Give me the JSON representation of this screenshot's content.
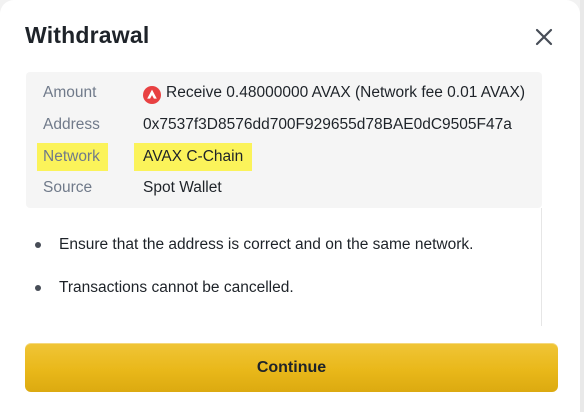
{
  "modal": {
    "title": "Withdrawal",
    "close_icon": "close-icon"
  },
  "details": {
    "amount": {
      "label": "Amount",
      "value": "Receive 0.48000000 AVAX (Network fee 0.01 AVAX)",
      "icon": "avax-icon"
    },
    "address": {
      "label": "Address",
      "value": "0x7537f3D8576dd700F929655d78BAE0dC9505F47a"
    },
    "network": {
      "label": "Network",
      "value": "AVAX C-Chain",
      "highlight_color": "#fbf35a"
    },
    "source": {
      "label": "Source",
      "value": "Spot Wallet"
    }
  },
  "notes": [
    "Ensure that the address is correct and on the same network.",
    "Transactions cannot be cancelled."
  ],
  "actions": {
    "continue_label": "Continue"
  },
  "colors": {
    "accent": "#f0b90b",
    "avax_red": "#e84142",
    "label_gray": "#707a8a",
    "text_dark": "#1e2329"
  }
}
